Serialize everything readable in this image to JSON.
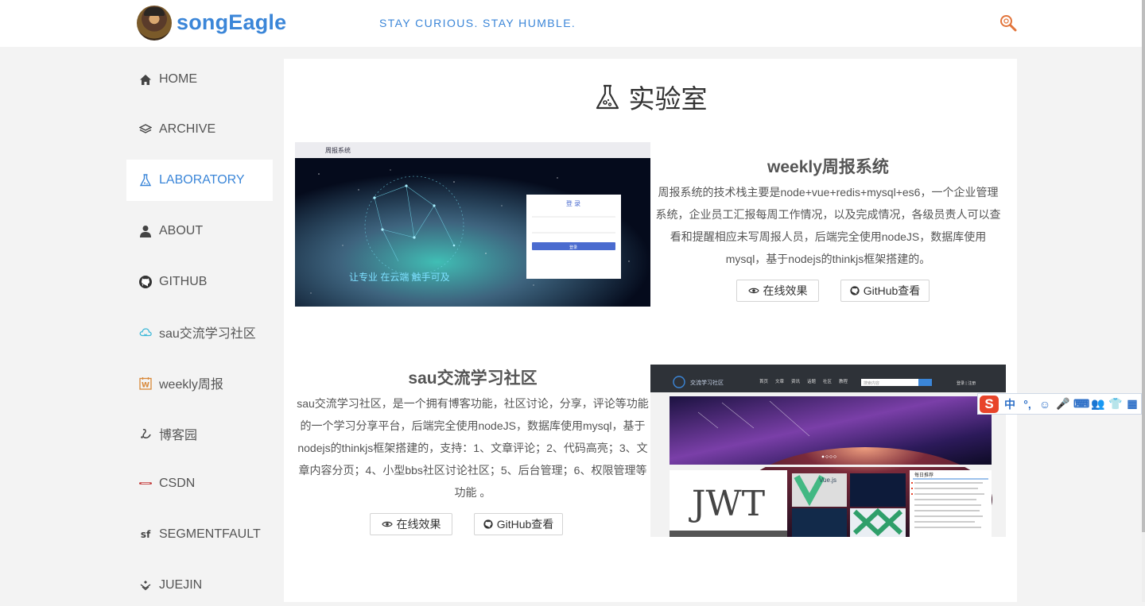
{
  "header": {
    "brand": "songEagle",
    "slogan": "STAY CURIOUS. STAY HUMBLE."
  },
  "sidebar": {
    "items": [
      {
        "label": "HOME",
        "icon": "home-icon"
      },
      {
        "label": "ARCHIVE",
        "icon": "layers-icon"
      },
      {
        "label": "LABORATORY",
        "icon": "flask-icon",
        "active": true
      },
      {
        "label": "ABOUT",
        "icon": "user-icon"
      },
      {
        "label": "GITHUB",
        "icon": "github-icon"
      },
      {
        "label": "sau交流学习社区",
        "icon": "cloud-icon"
      },
      {
        "label": "weekly周报",
        "icon": "weekly-icon"
      },
      {
        "label": "博客园",
        "icon": "cnblogs-icon"
      },
      {
        "label": "CSDN",
        "icon": "csdn-icon"
      },
      {
        "label": "SEGMENTFAULT",
        "icon": "segmentfault-icon"
      },
      {
        "label": "JUEJIN",
        "icon": "juejin-icon"
      }
    ]
  },
  "main": {
    "title": "实验室",
    "projects": [
      {
        "title": "weekly周报系统",
        "description": "周报系统的技术栈主要是node+vue+redis+mysql+es6，一个企业管理系统，企业员工汇报每周工作情况，以及完成情况，各级员责人可以查看和提醒相应未写周报人员，后端完全使用nodeJS，数据库使用mysql，基于nodejs的thinkjs框架搭建的。",
        "demo_label": "在线效果",
        "github_label": "GitHub查看",
        "screenshot": {
          "app_name": "周报系统",
          "login_title": "登 录",
          "login_button": "登录",
          "slogan": "让专业 在云端 触手可及"
        }
      },
      {
        "title": "sau交流学习社区",
        "description": "sau交流学习社区，是一个拥有博客功能，社区讨论，分享，评论等功能的一个学习分享平台，后端完全使用nodeJS，数据库使用mysql，基于nodejs的thinkjs框架搭建的，支持：1、文章评论；2、代码高亮；3、文章内容分页；4、小型bbs社区讨论社区；5、后台管理；6、权限管理等功能 。",
        "demo_label": "在线效果",
        "github_label": "GitHub查看",
        "screenshot": {
          "site_name": "交流学习社区",
          "nav": [
            "首页",
            "文章",
            "资讯",
            "话题",
            "社区",
            "教程"
          ],
          "search_placeholder": "搜索内容",
          "login": "登录 | 注册",
          "card_a": "Vue.js",
          "logo_text": "JWT",
          "side_title": "每日推荐"
        }
      }
    ]
  },
  "ime": {
    "s": "S",
    "items": [
      "中",
      "°,",
      "☺",
      "🎤",
      "⌨",
      "👥",
      "👕",
      "▦"
    ]
  }
}
